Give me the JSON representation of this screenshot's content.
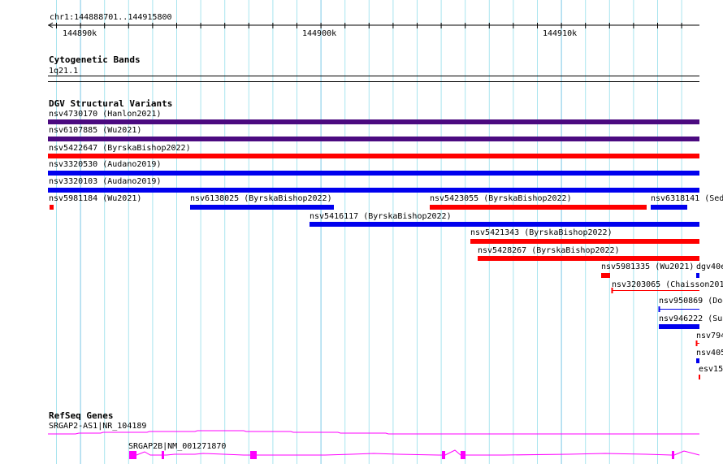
{
  "ruler": {
    "location": "chr1:144888701..144915800",
    "start": 144888701,
    "end": 144915800,
    "tick_labels": [
      "144890k",
      "144900k",
      "144910k"
    ]
  },
  "colors": {
    "grid_minor": "#a8e4ee",
    "grid_major": "#7cc8e6",
    "purple": "#4b0a80",
    "red": "#ff0000",
    "blue": "#0000ee",
    "gene": "#ff00ff"
  },
  "tracks": {
    "cytobands": {
      "title": "Cytogenetic Bands",
      "band": "1q21.1"
    },
    "dgv": {
      "title": "DGV Structural Variants",
      "features": [
        {
          "label": "nsv4730170 (Hanlon2021)",
          "color": "purple"
        },
        {
          "label": "nsv6107885 (Wu2021)",
          "color": "purple"
        },
        {
          "label": "nsv5422647 (ByrskaBishop2022)",
          "color": "red"
        },
        {
          "label": "nsv3320530 (Audano2019)",
          "color": "blue"
        },
        {
          "label": "nsv3320103 (Audano2019)",
          "color": "blue"
        },
        {
          "label": "nsv5981184 (Wu2021)",
          "color": "red"
        },
        {
          "label": "nsv6138025 (ByrskaBishop2022)",
          "color": "blue"
        },
        {
          "label": "nsv5423055 (ByrskaBishop2022)",
          "color": "red"
        },
        {
          "label": "nsv6318141 (Sed",
          "color": "blue"
        },
        {
          "label": "nsv5416117 (ByrskaBishop2022)",
          "color": "blue"
        },
        {
          "label": "nsv5421343 (ByrskaBishop2022)",
          "color": "red"
        },
        {
          "label": "nsv5428267 (ByrskaBishop2022)",
          "color": "red"
        },
        {
          "label": "nsv5981335 (Wu2021)",
          "color": "red"
        },
        {
          "label": "dgv40e",
          "color": "blue"
        },
        {
          "label": "nsv3203065 (Chaisson201",
          "color": "red"
        },
        {
          "label": "nsv950869 (Dog",
          "color": "blue"
        },
        {
          "label": "nsv946222 (Suc",
          "color": "blue"
        },
        {
          "label": "nsv794",
          "color": "red"
        },
        {
          "label": "nsv405",
          "color": "blue"
        },
        {
          "label": "esv15",
          "color": "red"
        }
      ]
    },
    "genes": {
      "title": "RefSeq Genes",
      "features": [
        {
          "label": "SRGAP2-AS1|NR_104189"
        },
        {
          "label": "SRGAP2B|NM_001271870"
        }
      ]
    }
  }
}
